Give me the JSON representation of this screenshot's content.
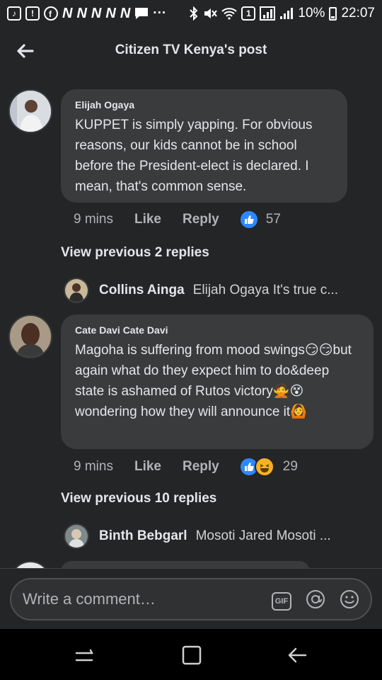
{
  "status_bar": {
    "battery": "10%",
    "time": "22:07",
    "sim_badge": "1",
    "app_letter": "N"
  },
  "header": {
    "title": "Citizen TV Kenya's post"
  },
  "comments": [
    {
      "author": "Elijah Ogaya",
      "text": "KUPPET is simply yapping. For obvious reasons, our kids cannot be in school before the President-elect is declared. I mean, that's common sense.",
      "time": "9 mins",
      "like_label": "Like",
      "reply_label": "Reply",
      "reaction_count": "57",
      "view_previous": "View previous 2 replies",
      "reply_preview": {
        "name": "Collins Ainga",
        "snippet": "Elijah Ogaya It's true c..."
      }
    },
    {
      "author": "Cate Davi Cate Davi",
      "text_part1": "Magoha is suffering from mood swings",
      "emoji_smirk": "😏",
      "text_part2": "but again what do they expect him to do&deep state is ashamed of Rutos victory",
      "emoji_person": "🙅",
      "emoji_dizzy": "😵",
      "text_part3": "wondering how they will announce it",
      "emoji_person2": "🙆",
      "time": "9 mins",
      "like_label": "Like",
      "reply_label": "Reply",
      "reaction_count": "29",
      "view_previous": "View previous 10 replies",
      "reply_preview": {
        "name": "Binth Bebgarl",
        "snippet": "Mosoti Jared Mosoti ..."
      }
    }
  ],
  "composer": {
    "placeholder": "Write a comment…",
    "gif_label": "GIF"
  },
  "colors": {
    "background": "#242526",
    "bubble": "#3a3b3c",
    "like_blue": "#2d88ff",
    "haha_yellow": "#f7b125"
  }
}
